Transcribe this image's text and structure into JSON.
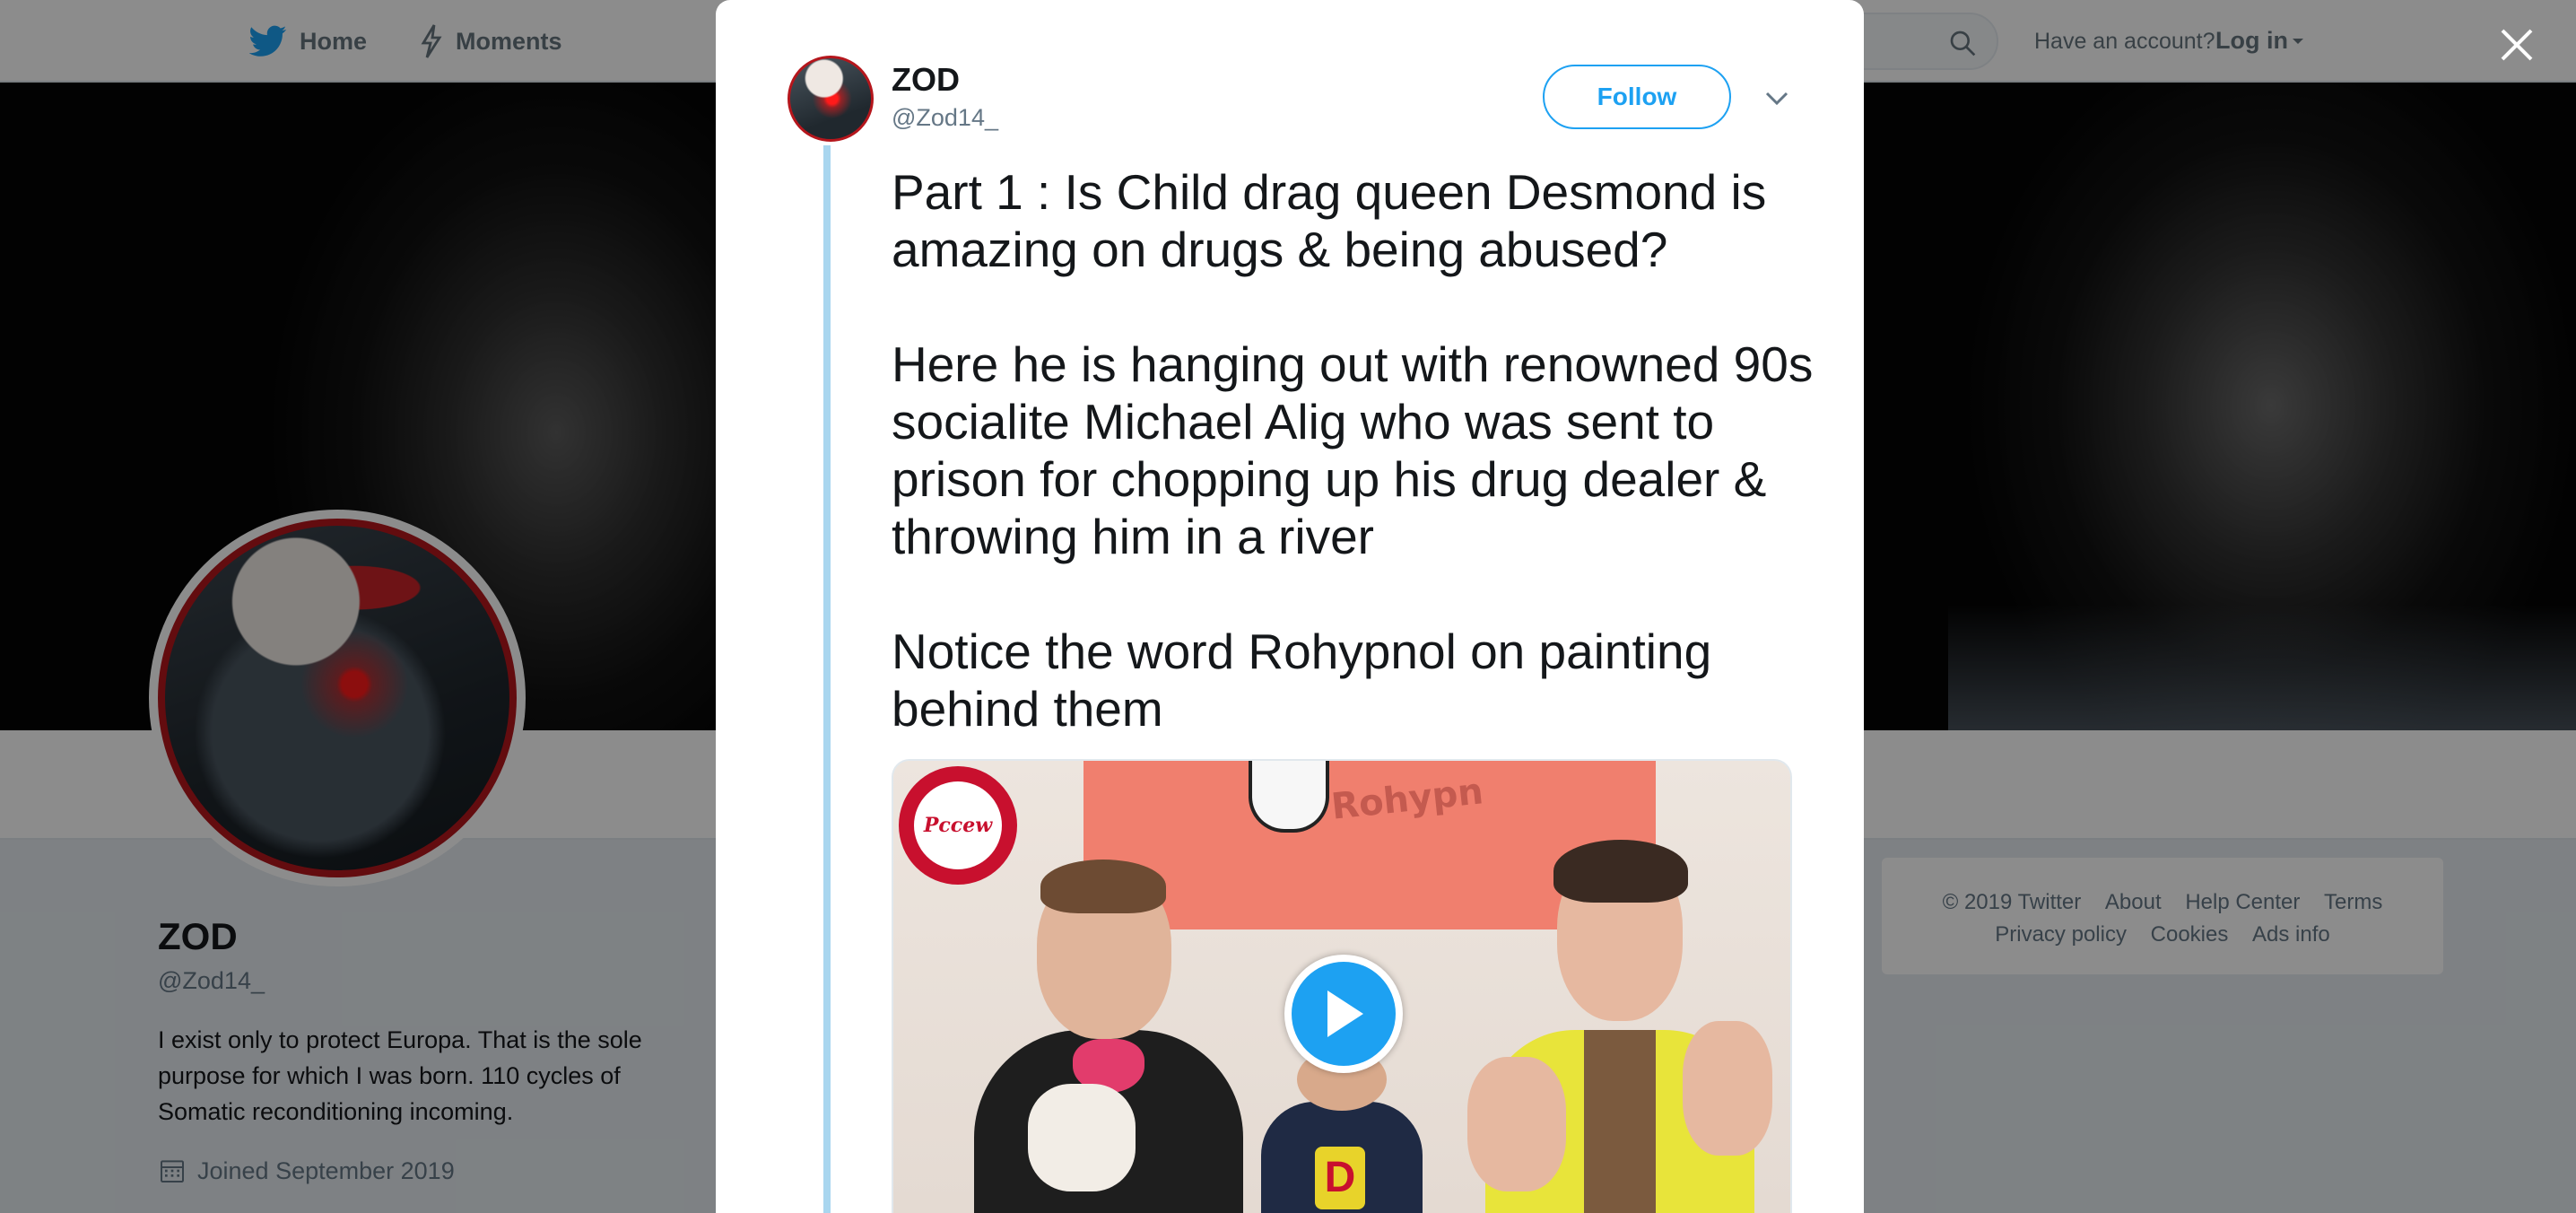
{
  "topnav": {
    "home_label": "Home",
    "moments_label": "Moments",
    "account_prompt": "Have an account?",
    "login_label": "Log in"
  },
  "profile": {
    "name": "ZOD",
    "handle": "@Zod14_",
    "bio": "I exist only to protect Europa. That is the sole purpose for which I was born. 110 cycles of Somatic reconditioning incoming.",
    "joined": "Joined September 2019"
  },
  "footer": {
    "copyright": "© 2019 Twitter",
    "about": "About",
    "help_center": "Help Center",
    "terms": "Terms",
    "privacy": "Privacy policy",
    "cookies": "Cookies",
    "ads_info": "Ads info"
  },
  "tweet": {
    "author_name": "ZOD",
    "author_handle": "@Zod14_",
    "follow_label": "Follow",
    "text": "Part 1 : Is Child drag queen Desmond is amazing on drugs & being abused?\n\nHere he is hanging out with renowned 90s socialite Michael Alig who was sent to prison for chopping up his drug dealer & throwing him in a river\n\nNotice the word Rohypnol on painting behind them",
    "media": {
      "watermark": "Pccew",
      "painting_word": "Rohypn",
      "shirt_letter": "D"
    }
  },
  "icons": {
    "twitter_bird": "twitter-bird-icon",
    "moments": "lightning-icon",
    "search": "search-icon",
    "caret": "chevron-down-icon",
    "close": "close-icon",
    "calendar": "calendar-icon",
    "play": "play-icon"
  },
  "colors": {
    "brand_blue": "#1da1f2",
    "thread_line": "#a9d6ef",
    "avatar_ring": "#b5161c"
  }
}
